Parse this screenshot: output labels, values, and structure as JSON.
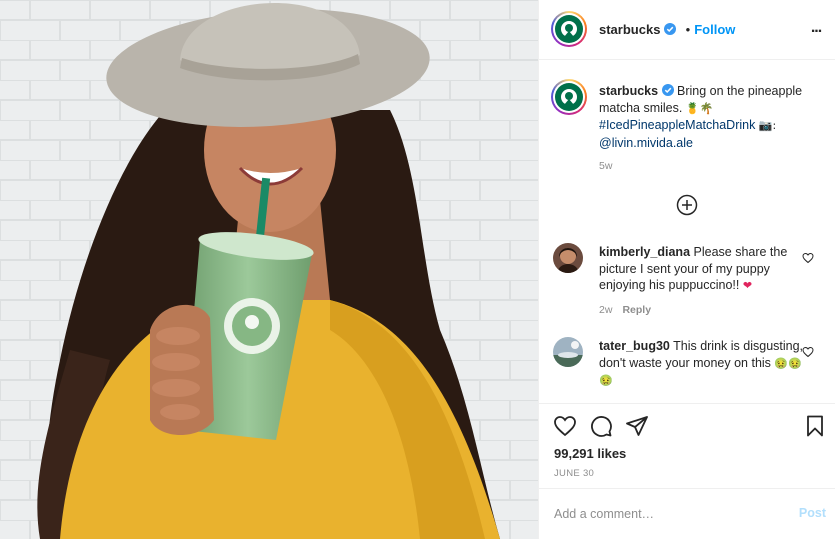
{
  "post": {
    "account": "starbucks",
    "separator": "•",
    "follow_label": "Follow",
    "more_label": "...",
    "caption": {
      "username": "starbucks",
      "text": "Bring on the pineapple matcha smiles.",
      "emojis": "🍍🌴",
      "hashtag": "#IcedPineappleMatchaDrink",
      "camera": "📷:",
      "mention": "@livin.mivida.ale",
      "time": "5w"
    },
    "comments": [
      {
        "username": "kimberly_diana",
        "text": "Please share the picture I sent your of my puppy enjoying his puppuccino!!",
        "emoji": "❤",
        "time": "2w",
        "reply_label": "Reply"
      },
      {
        "username": "tater_bug30",
        "text": "This drink is disgusting, don't waste your money on this",
        "emoji": "🤢🤢🤢"
      }
    ],
    "likes": "99,291 likes",
    "date": "JUNE 30",
    "comment_placeholder": "Add a comment…",
    "post_label": "Post"
  },
  "icons": {
    "verified": "verified-badge-icon",
    "load_more": "plus-circle-icon",
    "like": "heart-icon",
    "comment": "comment-icon",
    "share": "paper-plane-icon",
    "save": "bookmark-icon"
  },
  "colors": {
    "link": "#00376b",
    "follow": "#0095f6",
    "verified": "#3897f0",
    "starbucks_green": "#00704a",
    "matcha": "#86b784",
    "sweater": "#e9b22e"
  }
}
